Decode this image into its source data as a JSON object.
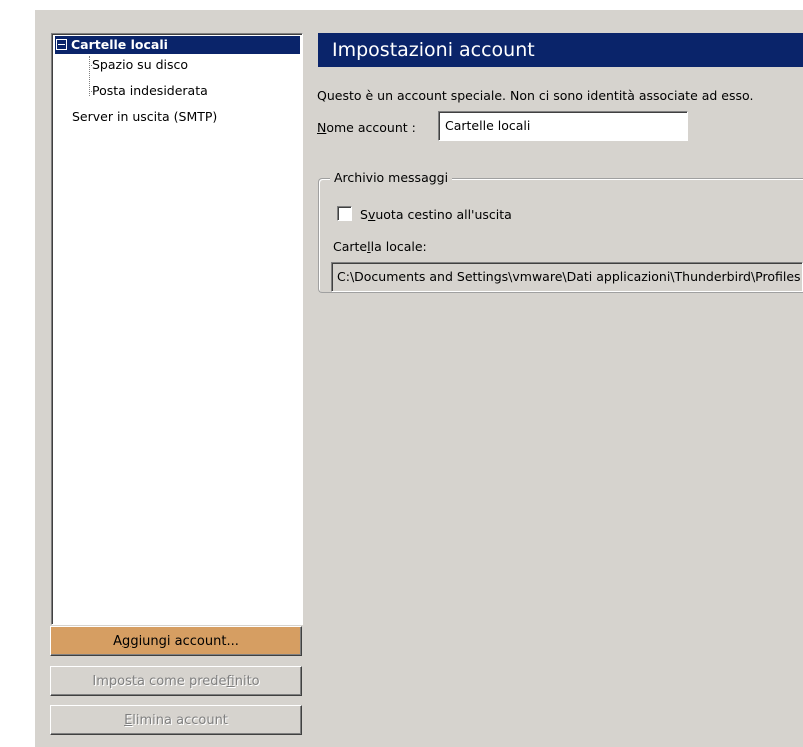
{
  "tree": {
    "root": "Cartelle locali",
    "children": [
      "Spazio su disco",
      "Posta indesiderata"
    ],
    "smtp": "Server in uscita (SMTP)"
  },
  "buttons": {
    "add": {
      "pre": "A",
      "key": "g",
      "post": "giungi account..."
    },
    "set_default": {
      "pre": "Imposta come prede",
      "key": "f",
      "post": "inito"
    },
    "delete": {
      "pre": "",
      "key": "E",
      "post": "limina account"
    }
  },
  "panel": {
    "title": "Impostazioni account",
    "description": "Questo è un account speciale. Non ci sono identità associate ad esso.",
    "name_label": {
      "key": "N",
      "post": "ome account :"
    },
    "name_value": "Cartelle locali"
  },
  "archive": {
    "legend": "Archivio messaggi",
    "empty_trash": {
      "pre": "S",
      "key": "v",
      "post": "uota cestino all'uscita",
      "checked": false
    },
    "local_folder_label": {
      "pre": "Carte",
      "key": "l",
      "post": "la locale:"
    },
    "local_folder_path": "C:\\Documents and Settings\\vmware\\Dati applicazioni\\Thunderbird\\Profiles"
  }
}
